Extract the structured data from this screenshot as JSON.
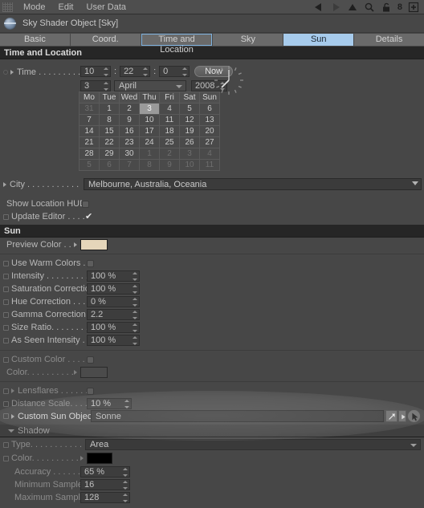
{
  "menubar": {
    "items": [
      "Mode",
      "Edit",
      "User Data"
    ],
    "icons": [
      "back-arrow-icon",
      "forward-arrow-icon",
      "up-arrow-icon",
      "magnifier-icon",
      "lock-icon",
      "history-count-icon",
      "add-panel-icon"
    ],
    "history_count": "8"
  },
  "object": {
    "title": "Sky Shader Object [Sky]",
    "icon": "sky-object-icon"
  },
  "tabs": [
    {
      "label": "Basic",
      "state": "normal"
    },
    {
      "label": "Coord.",
      "state": "normal"
    },
    {
      "label": "Time and Location",
      "state": "outlined"
    },
    {
      "label": "Sky",
      "state": "normal"
    },
    {
      "label": "Sun",
      "state": "selected"
    },
    {
      "label": "Details",
      "state": "normal"
    }
  ],
  "time_and_location": {
    "header": "Time and Location",
    "time_label": "Time . . . . . . . . .",
    "hour": "10",
    "minute": "22",
    "second": "0",
    "now_button": "Now",
    "day": "3",
    "month": "April",
    "year": "2008",
    "calendar": {
      "weekdays": [
        "Mo",
        "Tue",
        "Wed",
        "Thu",
        "Fri",
        "Sat",
        "Sun"
      ],
      "weeks": [
        [
          {
            "d": "31",
            "o": true
          },
          {
            "d": "1"
          },
          {
            "d": "2"
          },
          {
            "d": "3",
            "t": true
          },
          {
            "d": "4"
          },
          {
            "d": "5"
          },
          {
            "d": "6"
          }
        ],
        [
          {
            "d": "7"
          },
          {
            "d": "8"
          },
          {
            "d": "9"
          },
          {
            "d": "10"
          },
          {
            "d": "11"
          },
          {
            "d": "12"
          },
          {
            "d": "13"
          }
        ],
        [
          {
            "d": "14"
          },
          {
            "d": "15"
          },
          {
            "d": "16"
          },
          {
            "d": "17"
          },
          {
            "d": "18"
          },
          {
            "d": "19"
          },
          {
            "d": "20"
          }
        ],
        [
          {
            "d": "21"
          },
          {
            "d": "22"
          },
          {
            "d": "23"
          },
          {
            "d": "24"
          },
          {
            "d": "25"
          },
          {
            "d": "26"
          },
          {
            "d": "27"
          }
        ],
        [
          {
            "d": "28"
          },
          {
            "d": "29"
          },
          {
            "d": "30"
          },
          {
            "d": "1",
            "o": true
          },
          {
            "d": "2",
            "o": true
          },
          {
            "d": "3",
            "o": true
          },
          {
            "d": "4",
            "o": true
          }
        ],
        [
          {
            "d": "5",
            "o": true
          },
          {
            "d": "6",
            "o": true
          },
          {
            "d": "7",
            "o": true
          },
          {
            "d": "8",
            "o": true
          },
          {
            "d": "9",
            "o": true
          },
          {
            "d": "10",
            "o": true
          },
          {
            "d": "11",
            "o": true
          }
        ]
      ]
    },
    "city_label": "City . . . . . . . . . . . . .",
    "city_value": "Melbourne, Australia, Oceania",
    "show_location_hud_label": "Show Location HUD",
    "update_editor_label": "Update Editor . . . . . .",
    "update_editor_check": "✔"
  },
  "sun": {
    "header": "Sun",
    "preview_color_label": "Preview Color . . . .",
    "preview_color_value": "#e5d6ba",
    "use_warm_colors_label": "Use Warm Colors . . .",
    "fields": [
      {
        "label": "Intensity . . . . . . . . . .",
        "value": "100 %"
      },
      {
        "label": "Saturation Correction",
        "value": "100 %"
      },
      {
        "label": "Hue Correction . . . . .",
        "value": "0 %"
      },
      {
        "label": "Gamma Correction . .",
        "value": "2.2"
      },
      {
        "label": "Size Ratio. . . . . . . . .",
        "value": "100 %"
      },
      {
        "label": "As Seen Intensity . . .",
        "value": "100 %"
      }
    ],
    "custom_color_label": "Custom Color . . . . . .",
    "color_label": "Color. . . . . . . . . . . .",
    "color_value": "#4b4b4b",
    "lensflares_label": "Lensflares . . . . . . . .",
    "distance_scale_label": "Distance Scale. . . . . .",
    "distance_scale_value": "10 %",
    "custom_sun_object_label": "Custom Sun Object",
    "custom_sun_object_value": "Sonne"
  },
  "shadow": {
    "header": "Shadow",
    "type_label": "Type. . . . . . . . . . . .",
    "type_value": "Area",
    "color_label": "Color. . . . . . . . . . .",
    "color_value": "#000000",
    "rows": [
      {
        "label": "Accuracy . . . . . . .",
        "value": "65 %"
      },
      {
        "label": "Minimum Samples",
        "value": "16"
      },
      {
        "label": "Maximum Samples",
        "value": "128"
      }
    ]
  },
  "colors": {
    "accent": "#a7cbec",
    "outline": "#7fb3e0",
    "panel_bg": "#474747"
  }
}
